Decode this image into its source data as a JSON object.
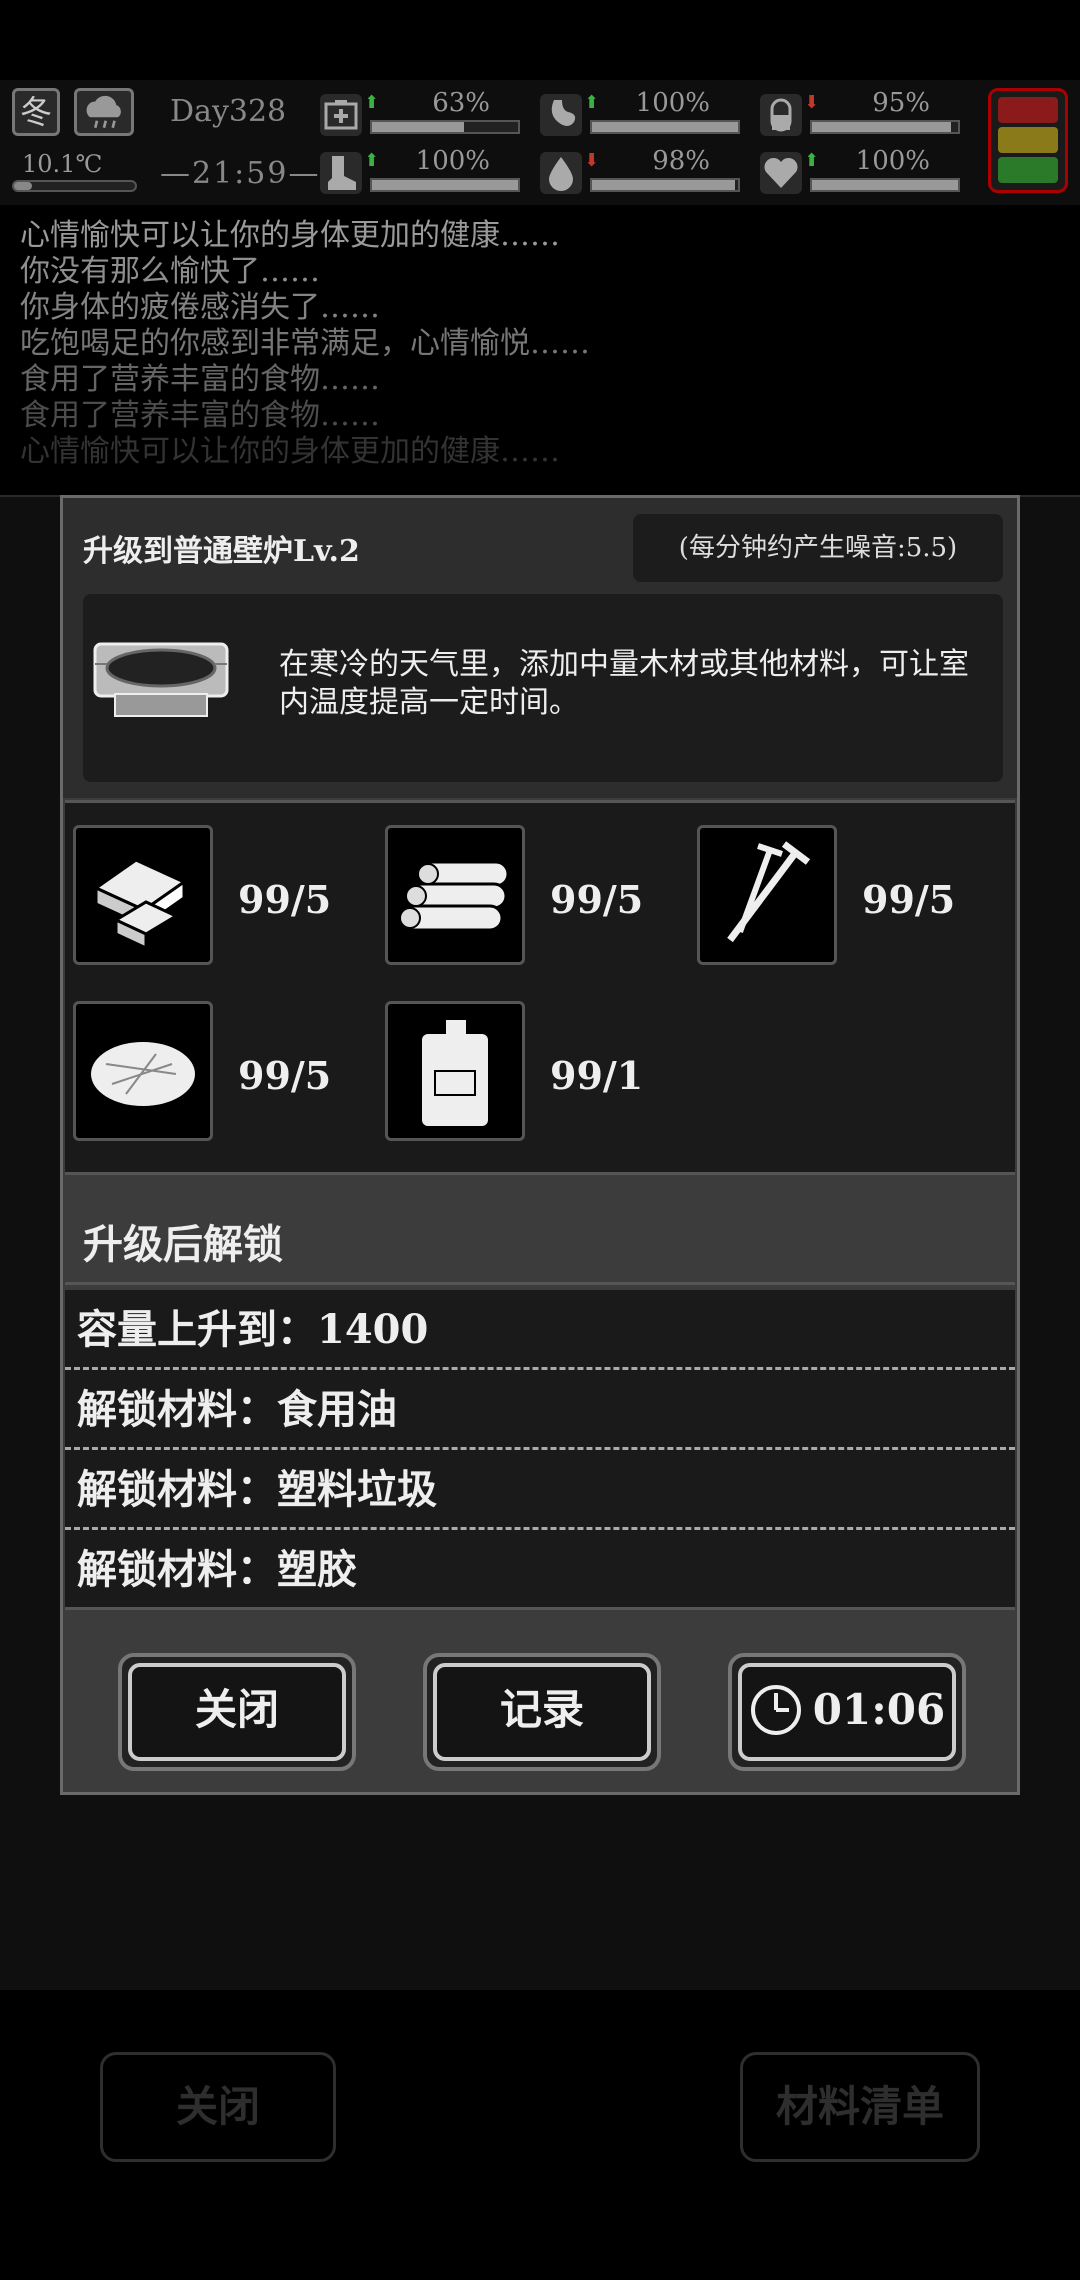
{
  "hud": {
    "season": "冬",
    "day": "Day328",
    "temperature": "10.1℃",
    "time": "—21:59—",
    "stats": [
      {
        "icon": "medkit-icon",
        "trend": "up",
        "value": "63%",
        "level": 0.63
      },
      {
        "icon": "stomach-icon",
        "trend": "up",
        "value": "100%",
        "level": 1.0
      },
      {
        "icon": "pill-icon",
        "trend": "down",
        "value": "95%",
        "level": 0.95
      },
      {
        "icon": "boot-icon",
        "trend": "up",
        "value": "100%",
        "level": 1.0
      },
      {
        "icon": "water-drop-icon",
        "trend": "down",
        "value": "98%",
        "level": 0.98
      },
      {
        "icon": "heart-icon",
        "trend": "up",
        "value": "100%",
        "level": 1.0
      }
    ],
    "status_colors": [
      "#8b1a1a",
      "#8a7a1a",
      "#2a7a2a"
    ]
  },
  "log": [
    "心情愉快可以让你的身体更加的健康……",
    "你没有那么愉快了……",
    "你身体的疲倦感消失了……",
    "吃饱喝足的你感到非常满足，心情愉悦……",
    "食用了营养丰富的食物……",
    "食用了营养丰富的食物……",
    "心情愉快可以让你的身体更加的健康……"
  ],
  "dialog": {
    "title": "升级到普通壁炉Lv.2",
    "noise": "(每分钟约产生噪音:5.5)",
    "description": "在寒冷的天气里，添加中量木材或其他材料，可让室内温度提高一定时间。",
    "materials": [
      {
        "icon": "wood-planks-icon",
        "qty": "99/5"
      },
      {
        "icon": "logs-icon",
        "qty": "99/5"
      },
      {
        "icon": "nails-icon",
        "qty": "99/5"
      },
      {
        "icon": "fiber-icon",
        "qty": "99/5"
      },
      {
        "icon": "fuel-can-icon",
        "qty": "99/1"
      }
    ],
    "unlock_title": "升级后解锁",
    "unlocks": [
      "容量上升到：1400",
      "解锁材料：食用油",
      "解锁材料：塑料垃圾",
      "解锁材料：塑胶"
    ],
    "close_label": "关闭",
    "record_label": "记录",
    "timer_label": "01:06"
  },
  "background": {
    "close_label": "关闭",
    "materials_list_label": "材料清单"
  }
}
